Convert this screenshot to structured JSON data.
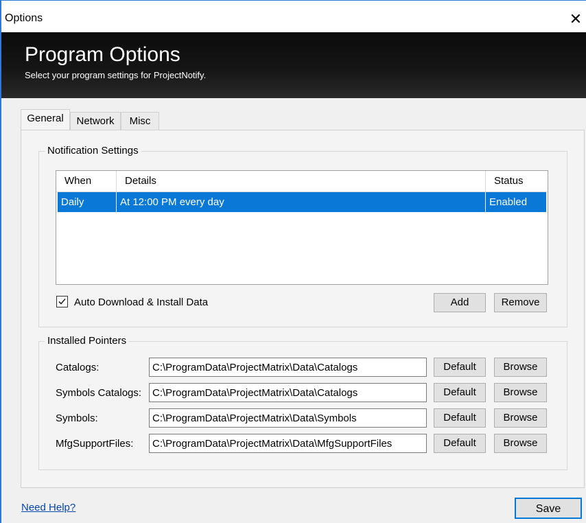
{
  "window": {
    "title": "Options",
    "close_glyph": "✕"
  },
  "banner": {
    "title": "Program Options",
    "subtitle": "Select your program settings for ProjectNotify."
  },
  "tabs": [
    {
      "label": "General",
      "active": true
    },
    {
      "label": "Network",
      "active": false
    },
    {
      "label": "Misc",
      "active": false
    }
  ],
  "notification": {
    "legend": "Notification Settings",
    "columns": [
      "When",
      "Details",
      "Status"
    ],
    "rows": [
      {
        "when": "Daily",
        "details": "At 12:00 PM every day",
        "status": "Enabled",
        "selected": true
      }
    ],
    "auto_download_label": "Auto Download & Install Data",
    "auto_download_checked": true,
    "add_label": "Add",
    "remove_label": "Remove"
  },
  "pointers": {
    "legend": "Installed Pointers",
    "default_label": "Default",
    "browse_label": "Browse",
    "items": [
      {
        "label": "Catalogs:",
        "value": "C:\\ProgramData\\ProjectMatrix\\Data\\Catalogs"
      },
      {
        "label": "Symbols Catalogs:",
        "value": "C:\\ProgramData\\ProjectMatrix\\Data\\Catalogs"
      },
      {
        "label": "Symbols:",
        "value": "C:\\ProgramData\\ProjectMatrix\\Data\\Symbols"
      },
      {
        "label": "MfgSupportFiles:",
        "value": "C:\\ProgramData\\ProjectMatrix\\Data\\MfgSupportFiles"
      }
    ]
  },
  "footer": {
    "help_link": "Need Help?",
    "save_label": "Save"
  },
  "colors": {
    "selection": "#0a78d7",
    "accent": "#0078d7",
    "link": "#0645ad"
  }
}
